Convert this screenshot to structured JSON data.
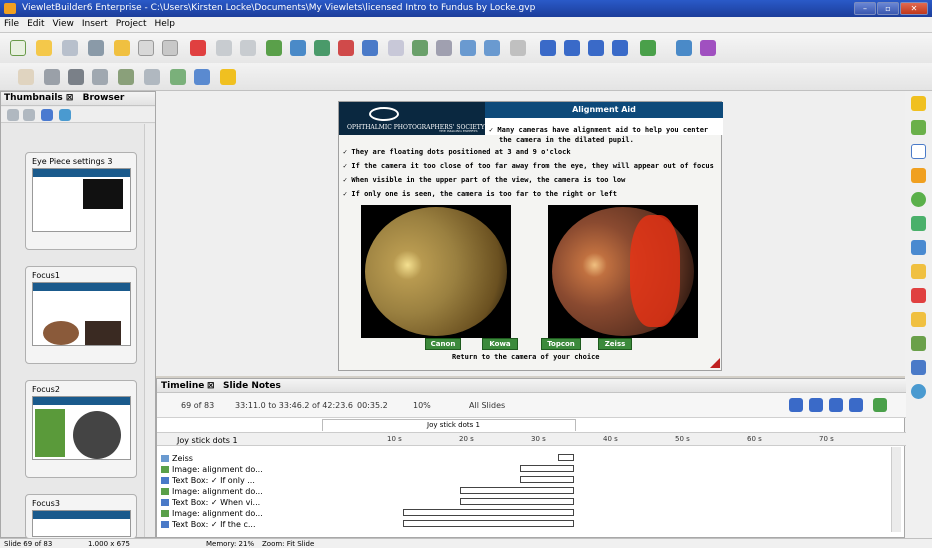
{
  "window": {
    "title": "ViewletBuilder6 Enterprise - C:\\Users\\Kirsten Locke\\Documents\\My Viewlets\\licensed Intro to Fundus by Locke.gvp"
  },
  "menu": [
    "File",
    "Edit",
    "View",
    "Insert",
    "Project",
    "Help"
  ],
  "left_panel": {
    "tabs": [
      "Thumbnails",
      "Browser"
    ],
    "thumbnails": [
      {
        "label": "Eye Piece settings 3"
      },
      {
        "label": "Focus1"
      },
      {
        "label": "Focus2"
      },
      {
        "label": "Focus3"
      }
    ]
  },
  "slide": {
    "title": "Alignment Aid",
    "logo_text": "OPHTHALMIC PHOTOGRAPHERS' SOCIETY",
    "logo_sub": "THE IMAGING EXPERTS",
    "intro": "✓ Many cameras have alignment aid to help you center",
    "intro2": "the camera in the dilated pupil.",
    "bullets": [
      "✓ They are floating dots positioned at 3 and 9 o'clock",
      "✓ If the camera it too close of too far away from the eye, they will appear out of focus",
      "✓ When visible in the upper part of the view, the camera is too low",
      "✓ If only one is seen, the camera is too far to the right or left"
    ],
    "buttons": [
      "Canon",
      "Kowa",
      "Topcon",
      "Zeiss"
    ],
    "footer": "Return to the camera of your choice"
  },
  "timeline": {
    "tabs": [
      "Timeline",
      "Slide Notes"
    ],
    "slide_pos": "69 of 83",
    "time_range": "33:11.0 to 33:46.2 of 42:23.6",
    "duration": "00:35.2",
    "zoom": "10%",
    "all_slides": "All Slides",
    "scene_label": "Joy stick dots 1",
    "tracks_header": "Joy stick dots 1",
    "ticks": [
      "10 s",
      "20 s",
      "30 s",
      "40 s",
      "50 s",
      "60 s",
      "70 s"
    ],
    "rows": [
      {
        "label": "Zeiss"
      },
      {
        "label": "Image: alignment do..."
      },
      {
        "label": "Text Box: ✓ If only ..."
      },
      {
        "label": "Image: alignment do..."
      },
      {
        "label": "Text Box: ✓ When vi..."
      },
      {
        "label": "Image: alignment do..."
      },
      {
        "label": "Text Box: ✓ If the c..."
      }
    ]
  },
  "status": {
    "slide": "Slide 69 of 83",
    "size": "1.000 x 675",
    "memory": "Memory: 21%",
    "zoom": "Zoom: Fit Slide"
  }
}
